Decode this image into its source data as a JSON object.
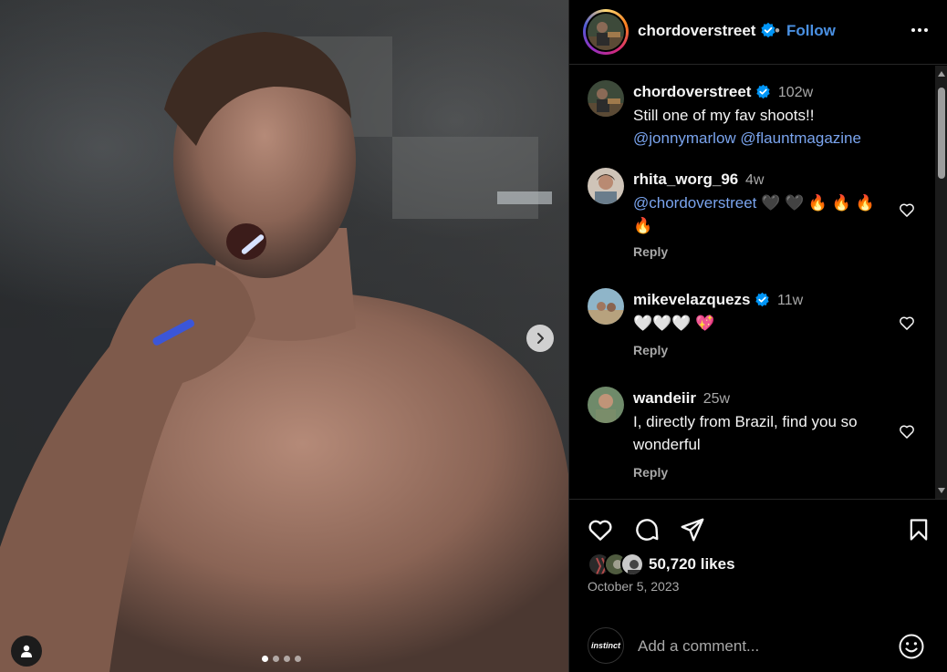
{
  "post": {
    "username": "chordoverstreet",
    "follow_label": "Follow",
    "bullet": "•",
    "carousel_dots": 4,
    "active_dot": 0
  },
  "comments": [
    {
      "username": "chordoverstreet",
      "time": "102w",
      "text": "Still one of my fav shoots!!",
      "mentions": "@jonnymarlow @flauntmagazine",
      "verified": true,
      "is_caption": true
    },
    {
      "username": "rhita_worg_96",
      "time": "4w",
      "mention": "@chordoverstreet",
      "text": "🖤 🖤 🔥 🔥 🔥 🔥",
      "reply_label": "Reply"
    },
    {
      "username": "mikevelazquezs",
      "time": "11w",
      "text": "🤍🤍🤍 💖",
      "verified": true,
      "reply_label": "Reply"
    },
    {
      "username": "wandeiir",
      "time": "25w",
      "text": "I, directly from Brazil, find you so wonderful",
      "reply_label": "Reply"
    }
  ],
  "stats": {
    "likes": "50,720 likes",
    "date": "October 5, 2023"
  },
  "add_comment": {
    "placeholder": "Add a comment...",
    "avatar_text": "instinct"
  },
  "colors": {
    "accent": "#4a90e2",
    "mention": "#7aa4ee",
    "verified": "#0095f6",
    "muted": "#a8a8a8"
  }
}
